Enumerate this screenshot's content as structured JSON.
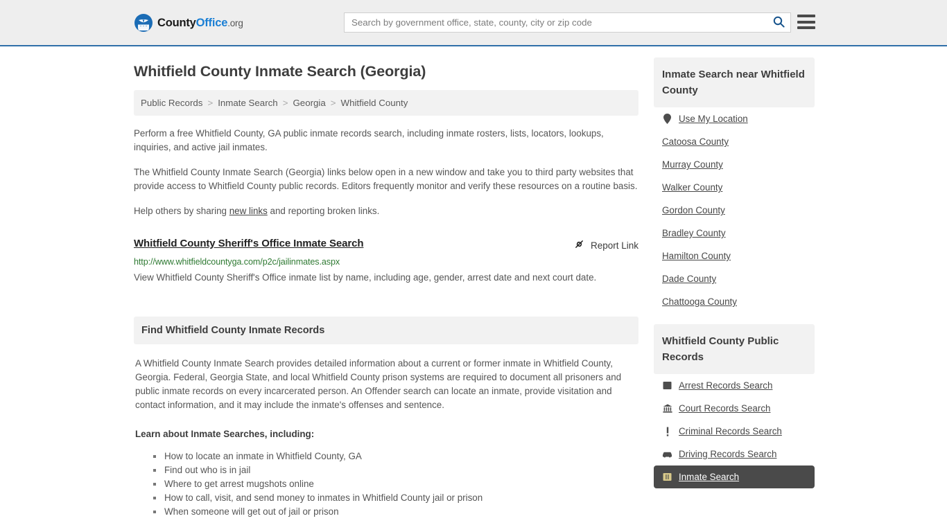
{
  "header": {
    "brand": {
      "part1": "County",
      "part2": "Office",
      "tld": ".org",
      "logo_icon": "eagle-shield-logo"
    },
    "search": {
      "placeholder": "Search by government office, state, county, city or zip code",
      "value": "",
      "icon": "search-icon"
    },
    "menu": {
      "icon": "hamburger-menu-icon",
      "label": "Menu"
    }
  },
  "page": {
    "title": "Whitfield County Inmate Search (Georgia)"
  },
  "breadcrumb": {
    "separator": ">",
    "items": [
      {
        "label": "Public Records"
      },
      {
        "label": "Inmate Search"
      },
      {
        "label": "Georgia"
      },
      {
        "label": "Whitfield County"
      }
    ]
  },
  "intro": {
    "p1": "Perform a free Whitfield County, GA public inmate records search, including inmate rosters, lists, locators, lookups, inquiries, and active jail inmates.",
    "p2": "The Whitfield County Inmate Search (Georgia) links below open in a new window and take you to third party websites that provide access to Whitfield County public records. Editors frequently monitor and verify these resources on a routine basis.",
    "p3_before": "Help others by sharing ",
    "p3_link": "new links",
    "p3_after": " and reporting broken links."
  },
  "result": {
    "title": "Whitfield County Sheriff's Office Inmate Search",
    "url": "http://www.whitfieldcountyga.com/p2c/jailinmates.aspx",
    "description": "View Whitfield County Sheriff's Office inmate list by name, including age, gender, arrest date and next court date.",
    "report_label": "Report Link",
    "report_icon": "broken-link-icon"
  },
  "section": {
    "heading": "Find Whitfield County Inmate Records",
    "paragraph": "A Whitfield County Inmate Search provides detailed information about a current or former inmate in Whitfield County, Georgia. Federal, Georgia State, and local Whitfield County prison systems are required to document all prisoners and public inmate records on every incarcerated person. An Offender search can locate an inmate, provide visitation and contact information, and it may include the inmate's offenses and sentence.",
    "list_heading": "Learn about Inmate Searches, including:",
    "bullets": [
      "How to locate an inmate in Whitfield County, GA",
      "Find out who is in jail",
      "Where to get arrest mugshots online",
      "How to call, visit, and send money to inmates in Whitfield County jail or prison",
      "When someone will get out of jail or prison"
    ]
  },
  "sidebar": {
    "nearby": {
      "heading": "Inmate Search near Whitfield County",
      "items": [
        {
          "label": "Use My Location",
          "icon": "map-pin-icon"
        },
        {
          "label": "Catoosa County",
          "icon": ""
        },
        {
          "label": "Murray County",
          "icon": ""
        },
        {
          "label": "Walker County",
          "icon": ""
        },
        {
          "label": "Gordon County",
          "icon": ""
        },
        {
          "label": "Bradley County",
          "icon": ""
        },
        {
          "label": "Hamilton County",
          "icon": ""
        },
        {
          "label": "Dade County",
          "icon": ""
        },
        {
          "label": "Chattooga County",
          "icon": ""
        }
      ]
    },
    "public_records": {
      "heading": "Whitfield County Public Records",
      "items": [
        {
          "label": "Arrest Records Search",
          "icon": "fingerprint-icon",
          "active": false
        },
        {
          "label": "Court Records Search",
          "icon": "courthouse-icon",
          "active": false
        },
        {
          "label": "Criminal Records Search",
          "icon": "exclamation-icon",
          "active": false
        },
        {
          "label": "Driving Records Search",
          "icon": "car-icon",
          "active": false
        },
        {
          "label": "Inmate Search",
          "icon": "inmate-icon",
          "active": true
        }
      ]
    }
  },
  "colors": {
    "header_bg": "#eeeeee",
    "header_border": "#2f6fa8",
    "brand_blue": "#1b7fd4",
    "panel_bg": "#f2f2f2",
    "url_green": "#2f7a33",
    "active_bg": "#4a4a4a",
    "text": "#555555"
  }
}
